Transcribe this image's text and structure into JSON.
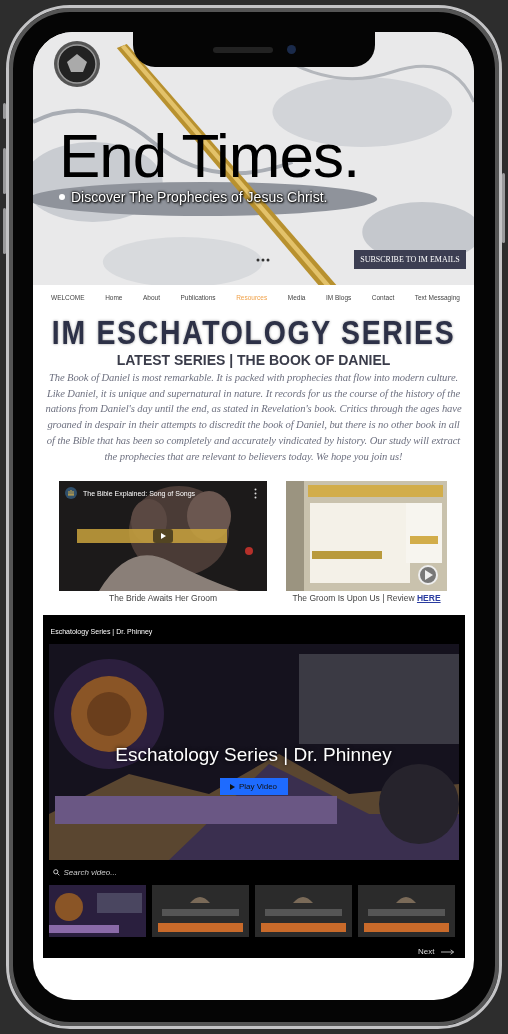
{
  "hero": {
    "heading": "End Times.",
    "tagline": "Discover The Prophecies of Jesus Christ.",
    "subscribe_button": "SUBSCRIBE TO IM EMAILS"
  },
  "nav": [
    {
      "label": "WELCOME",
      "selected": false
    },
    {
      "label": "Home",
      "selected": false
    },
    {
      "label": "About",
      "selected": false
    },
    {
      "label": "Publications",
      "selected": false
    },
    {
      "label": "Resources",
      "selected": true
    },
    {
      "label": "Media",
      "selected": false
    },
    {
      "label": "IM Blogs",
      "selected": false
    },
    {
      "label": "Contact",
      "selected": false
    },
    {
      "label": "Text Messaging",
      "selected": false
    }
  ],
  "series": {
    "title": "IM ESCHATOLOGY SERIES",
    "subtitle": "LATEST SERIES | THE BOOK OF DANIEL",
    "body": "The Book of Daniel is most remarkable. It is packed with prophecies that flow into modern culture. Like Daniel, it is unique and supernatural in nature. It records for us the course of the history of the nations from Daniel's day until the end, as stated in Revelation's book. Critics through the ages have groaned in despair in their attempts to discredit the book of Daniel, but there is no other book in all of the Bible that has been so completely and accurately vindicated by history. Our study will extract the prophecies that are relevant to believers today. We hope you join us!"
  },
  "media": [
    {
      "kind": "video",
      "video_title": "The Bible Explained: Song of Songs",
      "caption": "The Bride Awaits Her Groom"
    },
    {
      "kind": "brochure",
      "caption": "The Groom Is Upon Us | Review",
      "link": "HERE"
    }
  ],
  "player": {
    "channel_title": "Eschatology Series | Dr. Phinney",
    "overlay_title": "Eschatology Series | Dr. Phinney",
    "play_button": "Play Video",
    "search": {
      "placeholder": "Search video..."
    },
    "next_button": "Next"
  }
}
